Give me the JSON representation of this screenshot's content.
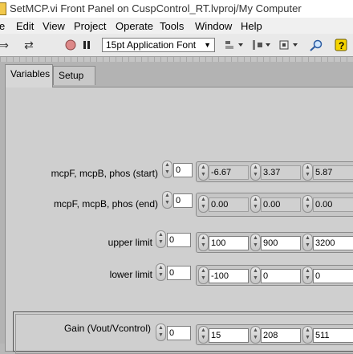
{
  "window": {
    "title": "SetMCP.vi Front Panel on CuspControl_RT.lvproj/My Computer"
  },
  "menu": [
    "e",
    "Edit",
    "View",
    "Project",
    "Operate",
    "Tools",
    "Window",
    "Help"
  ],
  "toolbar": {
    "font": "15pt Application Font",
    "icons": [
      "run-arrow-icon",
      "run-continuously-icon",
      "abort-icon",
      "pause-icon",
      "align-icon",
      "distribute-icon",
      "resize-icon",
      "reorder-icon",
      "search-icon",
      "help-icon"
    ]
  },
  "tabs": [
    {
      "label": "Variables",
      "active": true
    },
    {
      "label": "Setup",
      "active": false
    }
  ],
  "controls": {
    "start": {
      "label": "mcpF, mcpB, phos (start)",
      "index": "0",
      "values": [
        "-6.67",
        "3.37",
        "5.87"
      ]
    },
    "end": {
      "label": "mcpF, mcpB, phos (end)",
      "index": "0",
      "values": [
        "0.00",
        "0.00",
        "0.00"
      ]
    },
    "upper": {
      "label": "upper limit",
      "index": "0",
      "values": [
        "100",
        "900",
        "3200"
      ]
    },
    "lower": {
      "label": "lower limit",
      "index": "0",
      "values": [
        "-100",
        "0",
        "0"
      ]
    },
    "gain": {
      "label": "Gain (Vout/Vcontrol)",
      "index": "0",
      "values": [
        "15",
        "208",
        "511"
      ]
    }
  }
}
